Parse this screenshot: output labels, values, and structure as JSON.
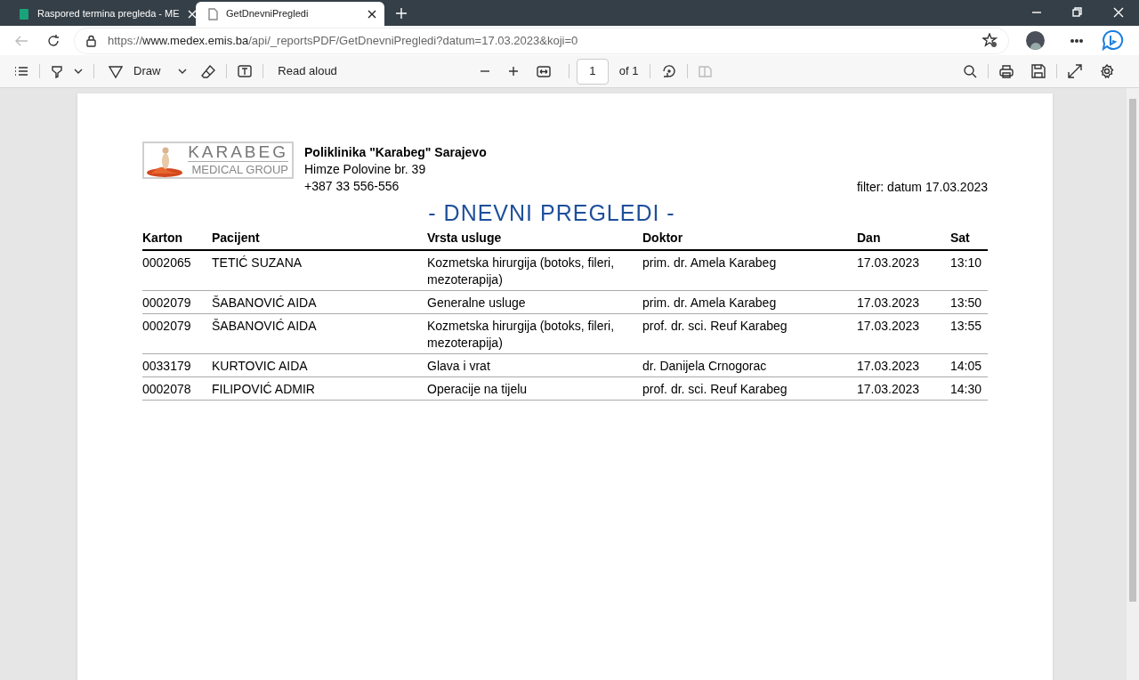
{
  "tabs": [
    {
      "label": "Raspored termina pregleda - ME",
      "selected": false,
      "kind": "app"
    },
    {
      "label": "GetDnevniPregledi",
      "selected": true,
      "kind": "doc"
    }
  ],
  "address_bar": {
    "prefix": "https://",
    "host": "www.medex.emis.ba",
    "path": "/api/_reportsPDF/GetDnevniPregledi?datum=17.03.2023&koji=0"
  },
  "pdf_toolbar": {
    "draw": "Draw",
    "read_aloud": "Read aloud",
    "page": "1",
    "page_count": "of 1"
  },
  "report": {
    "logo_top": "KARABEG",
    "logo_bottom": "MEDICAL GROUP",
    "clinic": "Poliklinika \"Karabeg\" Sarajevo",
    "address": "Himze Polovine br. 39",
    "phone": "+387 33 556-556",
    "filter": "filter: datum 17.03.2023",
    "title": "- DNEVNI PREGLEDI -",
    "columns": [
      "Karton",
      "Pacijent",
      "Vrsta usluge",
      "Doktor",
      "Dan",
      "Sat"
    ],
    "rows": [
      [
        "0002065",
        "TETIĆ SUZANA",
        "Kozmetska hirurgija (botoks, fileri, mezoterapija)",
        "prim. dr. Amela Karabeg",
        "17.03.2023",
        "13:10"
      ],
      [
        "0002079",
        "ŠABANOVIĆ AIDA",
        "Generalne usluge",
        "prim. dr. Amela Karabeg",
        "17.03.2023",
        "13:50"
      ],
      [
        "0002079",
        "ŠABANOVIĆ AIDA",
        "Kozmetska hirurgija (botoks, fileri, mezoterapija)",
        "prof. dr. sci. Reuf Karabeg",
        "17.03.2023",
        "13:55"
      ],
      [
        "0033179",
        "KURTOVIC AIDA",
        "Glava i vrat",
        "dr. Danijela Crnogorac",
        "17.03.2023",
        "14:05"
      ],
      [
        "0002078",
        "FILIPOVIĆ ADMIR",
        "Operacije na tijelu",
        "prof. dr. sci. Reuf Karabeg",
        "17.03.2023",
        "14:30"
      ]
    ]
  }
}
